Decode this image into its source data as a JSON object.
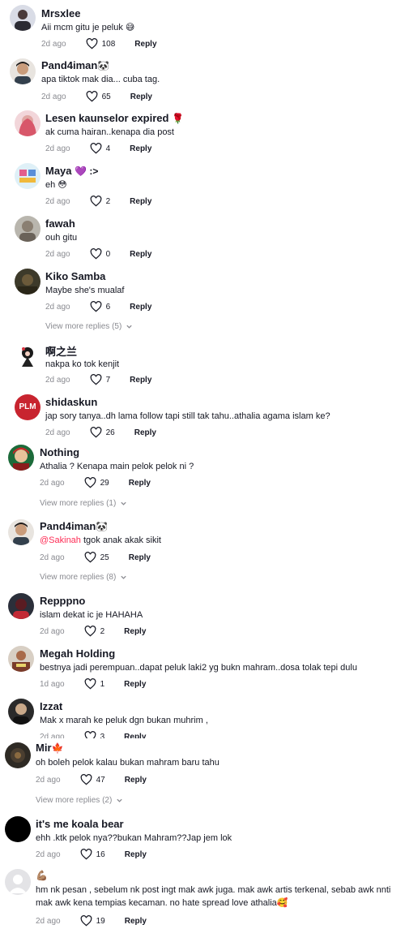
{
  "comments": [
    {
      "name": "Mrsxlee",
      "badge": "",
      "text": "Aii mcm gitu je peluk 😅",
      "time": "2d ago",
      "likes": "108",
      "reply": "Reply"
    },
    {
      "name": "Pand4iman",
      "badge": "🐼",
      "text": "apa tiktok mak dia... cuba tag.",
      "time": "2d ago",
      "likes": "65",
      "reply": "Reply"
    },
    {
      "name": "Lesen kaunselor expired",
      "badge": "🌹",
      "text": "ak cuma hairan..kenapa dia post",
      "time": "2d ago",
      "likes": "4",
      "reply": "Reply"
    },
    {
      "name": "Maya",
      "badge": "💜 :>",
      "text": "eh 😳",
      "time": "2d ago",
      "likes": "2",
      "reply": "Reply"
    },
    {
      "name": "fawah",
      "badge": "",
      "text": "ouh gitu",
      "time": "2d ago",
      "likes": "0",
      "reply": "Reply"
    },
    {
      "name": "Kiko Samba",
      "badge": "",
      "text": "Maybe she's mualaf",
      "time": "2d ago",
      "likes": "6",
      "reply": "Reply",
      "view_more": "View more replies (5)"
    },
    {
      "name": "啊之兰",
      "badge": "",
      "text": "nakpa ko tok kenjit",
      "time": "2d ago",
      "likes": "7",
      "reply": "Reply"
    },
    {
      "name": "shidaskun",
      "badge": "",
      "text": "jap sory tanya..dh lama follow tapi still tak tahu..athalia agama islam ke?",
      "time": "2d ago",
      "likes": "26",
      "reply": "Reply",
      "avatar_text": "PLM"
    },
    {
      "name": "Nothing",
      "badge": "",
      "text": "Athalia ? Kenapa main pelok pelok ni ?",
      "time": "2d ago",
      "likes": "29",
      "reply": "Reply",
      "view_more": "View more replies (1)"
    },
    {
      "name": "Pand4iman",
      "badge": "🐼",
      "mention": "@Sakinah",
      "text": " tgok anak akak sikit",
      "time": "2d ago",
      "likes": "25",
      "reply": "Reply",
      "view_more": "View more replies (8)"
    },
    {
      "name": "Repppno",
      "badge": "",
      "text": "islam dekat ic je HAHAHA",
      "time": "2d ago",
      "likes": "2",
      "reply": "Reply"
    },
    {
      "name": "Megah Holding",
      "badge": "",
      "text": "bestnya jadi perempuan..dapat peluk laki2 yg bukn mahram..dosa tolak tepi dulu",
      "time": "1d ago",
      "likes": "1",
      "reply": "Reply"
    },
    {
      "name": "Izzat",
      "badge": "",
      "text": "Mak x marah ke peluk dgn bukan muhrim ,",
      "time": "2d ago",
      "likes": "3",
      "reply": "Reply"
    },
    {
      "name": "Mir",
      "badge": "🍁",
      "text": "oh boleh pelok kalau bukan mahram baru tahu",
      "time": "2d ago",
      "likes": "47",
      "reply": "Reply",
      "view_more": "View more replies (2)"
    },
    {
      "name": "it's me koala bear",
      "badge": "",
      "text": "ehh .ktk pelok nya??bukan Mahram??Jap jem lok",
      "time": "2d ago",
      "likes": "16",
      "reply": "Reply"
    },
    {
      "name": "",
      "badge": "💪🏽",
      "text": "hm nk pesan , sebelum nk post ingt mak awk juga. mak awk artis terkenal, sebab awk nnti mak awk kena tempias kecaman. no hate spread love athalia🥰",
      "time": "2d ago",
      "likes": "19",
      "reply": "Reply"
    }
  ]
}
